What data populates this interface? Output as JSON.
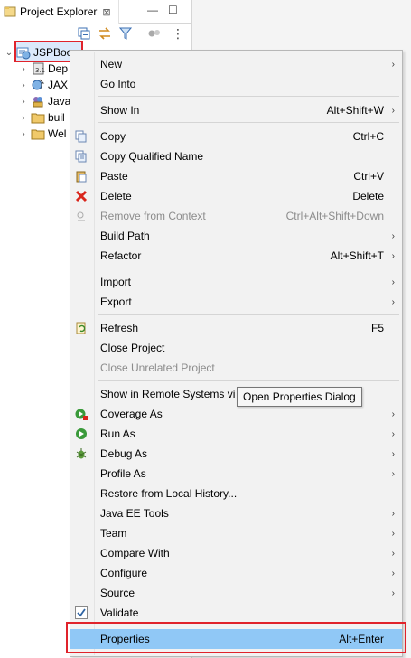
{
  "explorer": {
    "tab_title": "Project Explorer",
    "close_glyph": "⊠",
    "root_label": "JSPBoo",
    "children": [
      {
        "label": "Dep",
        "icon": "libraries-icon"
      },
      {
        "label": "JAX",
        "icon": "jax-ws-icon"
      },
      {
        "label": "Java",
        "icon": "java-resources-icon"
      },
      {
        "label": "buil",
        "icon": "folder-icon"
      },
      {
        "label": "Wel",
        "icon": "folder-icon"
      }
    ]
  },
  "menu": {
    "items": [
      {
        "label": "New",
        "shortcut": "",
        "arrow": true
      },
      {
        "label": "Go Into",
        "shortcut": "",
        "arrow": false
      },
      {
        "label": "Show In",
        "shortcut": "Alt+Shift+W",
        "arrow": true
      },
      {
        "label": "Copy",
        "shortcut": "Ctrl+C",
        "arrow": false
      },
      {
        "label": "Copy Qualified Name",
        "shortcut": "",
        "arrow": false
      },
      {
        "label": "Paste",
        "shortcut": "Ctrl+V",
        "arrow": false
      },
      {
        "label": "Delete",
        "shortcut": "Delete",
        "arrow": false
      },
      {
        "label": "Remove from Context",
        "shortcut": "Ctrl+Alt+Shift+Down",
        "arrow": false
      },
      {
        "label": "Build Path",
        "shortcut": "",
        "arrow": true
      },
      {
        "label": "Refactor",
        "shortcut": "Alt+Shift+T",
        "arrow": true
      },
      {
        "label": "Import",
        "shortcut": "",
        "arrow": true
      },
      {
        "label": "Export",
        "shortcut": "",
        "arrow": true
      },
      {
        "label": "Refresh",
        "shortcut": "F5",
        "arrow": false
      },
      {
        "label": "Close Project",
        "shortcut": "",
        "arrow": false
      },
      {
        "label": "Close Unrelated Project",
        "shortcut": "",
        "arrow": false
      },
      {
        "label": "Show in Remote Systems vi",
        "shortcut": "",
        "arrow": false
      },
      {
        "label": "Coverage As",
        "shortcut": "",
        "arrow": true
      },
      {
        "label": "Run As",
        "shortcut": "",
        "arrow": true
      },
      {
        "label": "Debug As",
        "shortcut": "",
        "arrow": true
      },
      {
        "label": "Profile As",
        "shortcut": "",
        "arrow": true
      },
      {
        "label": "Restore from Local History...",
        "shortcut": "",
        "arrow": false
      },
      {
        "label": "Java EE Tools",
        "shortcut": "",
        "arrow": true
      },
      {
        "label": "Team",
        "shortcut": "",
        "arrow": true
      },
      {
        "label": "Compare With",
        "shortcut": "",
        "arrow": true
      },
      {
        "label": "Configure",
        "shortcut": "",
        "arrow": true
      },
      {
        "label": "Source",
        "shortcut": "",
        "arrow": true
      },
      {
        "label": "Validate",
        "shortcut": "",
        "arrow": false
      },
      {
        "label": "Properties",
        "shortcut": "Alt+Enter",
        "arrow": false
      }
    ]
  },
  "tooltip": {
    "text": "Open Properties Dialog"
  },
  "glyphs": {
    "submenu_arrow": "›",
    "expand_arrow": "›",
    "collapse_arrow": "⌄",
    "minimize": "—",
    "maximize": "☐",
    "view_menu": "⋮"
  },
  "colors": {
    "selection": "#90c8f6",
    "highlight_border": "#e0232b",
    "menu_bg": "#f2f2f2"
  }
}
